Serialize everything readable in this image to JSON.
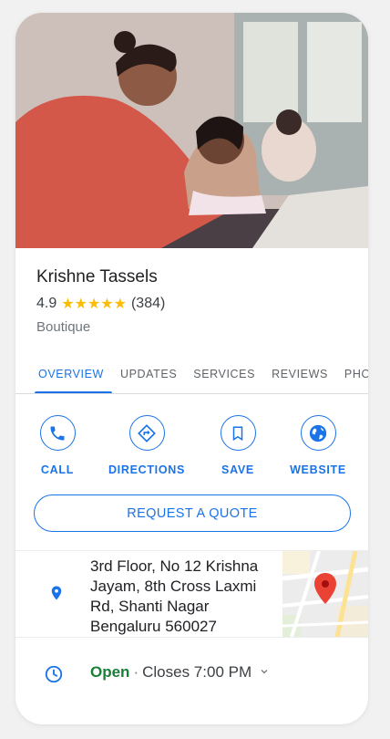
{
  "business": {
    "name": "Krishne Tassels",
    "rating": "4.9",
    "stars": "★★★★★",
    "review_count": "(384)",
    "category": "Boutique"
  },
  "tabs": [
    {
      "label": "OVERVIEW",
      "active": true
    },
    {
      "label": "UPDATES",
      "active": false
    },
    {
      "label": "SERVICES",
      "active": false
    },
    {
      "label": "REVIEWS",
      "active": false
    },
    {
      "label": "PHOTOS",
      "active": false
    }
  ],
  "actions": [
    {
      "label": "CALL",
      "icon": "phone-icon"
    },
    {
      "label": "DIRECTIONS",
      "icon": "directions-icon"
    },
    {
      "label": "SAVE",
      "icon": "bookmark-icon"
    },
    {
      "label": "WEBSITE",
      "icon": "globe-icon"
    }
  ],
  "quote_button": "REQUEST A QUOTE",
  "address": {
    "line1": "3rd Floor, No 12 Krishna",
    "line2": "Jayam, 8th Cross Laxmi",
    "line3": "Rd, Shanti Nagar",
    "line4": "Bengaluru 560027",
    "icon": "location-pin-icon"
  },
  "hours": {
    "status": "Open",
    "separator": "·",
    "closes": "Closes 7:00 PM",
    "icon": "clock-icon"
  },
  "colors": {
    "accent": "#1a73e8",
    "star": "#fbbc04",
    "open_green": "#188038",
    "map_pin": "#ea4335"
  }
}
